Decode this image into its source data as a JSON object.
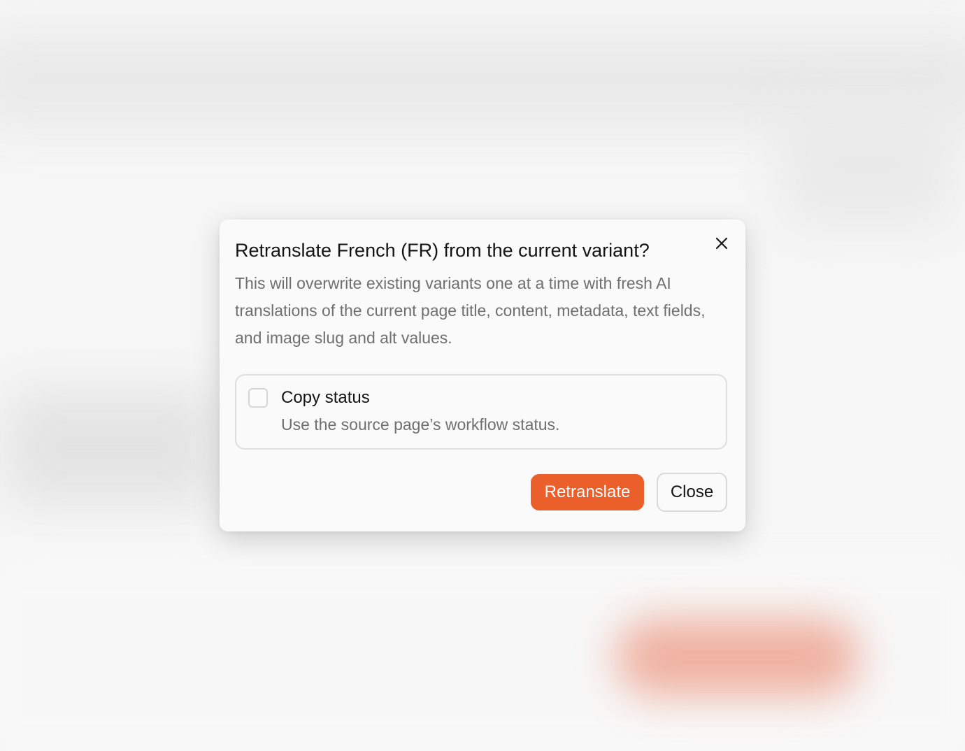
{
  "dialog": {
    "title": "Retranslate French (FR) from the current variant?",
    "description": "This will overwrite existing variants one at a time with fresh AI translations of the current page title, content, metadata, text fields, and image slug and alt values.",
    "close_icon": "close-icon",
    "option": {
      "label": "Copy status",
      "help": "Use the source page’s workflow status.",
      "checked": false
    },
    "buttons": {
      "primary_label": "Retranslate",
      "secondary_label": "Close"
    }
  },
  "colors": {
    "accent": "#eb5f2b",
    "text_primary": "#141414",
    "text_secondary": "#6f6f6f",
    "dialog_bg": "#fafafa",
    "border": "#dedede"
  }
}
